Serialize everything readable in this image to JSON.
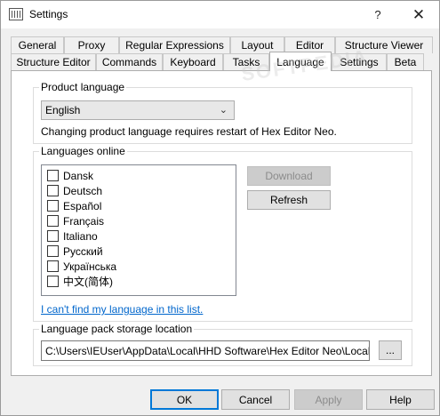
{
  "window": {
    "title": "Settings",
    "help_glyph": "?",
    "close_glyph": "✕"
  },
  "tabs": {
    "row1": [
      "General",
      "Proxy",
      "Regular Expressions",
      "Layout",
      "Editor",
      "Structure Viewer"
    ],
    "row2": [
      "Structure Editor",
      "Commands",
      "Keyboard",
      "Tasks",
      "Language",
      "Settings",
      "Beta"
    ],
    "active": "Language"
  },
  "product_language": {
    "group_label": "Product language",
    "selected": "English",
    "note": "Changing product language requires restart of Hex Editor Neo."
  },
  "languages_online": {
    "group_label": "Languages online",
    "items": [
      "Dansk",
      "Deutsch",
      "Español",
      "Français",
      "Italiano",
      "Русский",
      "Українська",
      "中文(简体)"
    ],
    "download_label": "Download",
    "refresh_label": "Refresh",
    "cant_find_link": "I can't find my language in this list."
  },
  "storage": {
    "group_label": "Language pack storage location",
    "path": "C:\\Users\\IEUser\\AppData\\Local\\HHD Software\\Hex Editor Neo\\Localization\\",
    "browse_label": "..."
  },
  "footer": {
    "ok_label": "OK",
    "cancel_label": "Cancel",
    "apply_label": "Apply",
    "help_label": "Help"
  },
  "watermark": "SOFTPEDIA",
  "icons": {
    "app": "hex-editor-app-icon",
    "dropdown": "chevron-down-icon",
    "close": "close-icon",
    "help": "help-icon"
  }
}
